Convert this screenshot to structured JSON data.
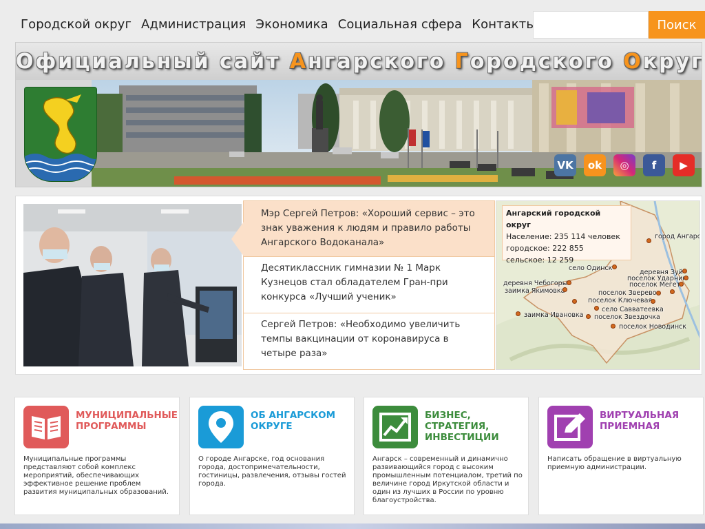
{
  "nav": {
    "items": [
      "Городской округ",
      "Администрация",
      "Экономика",
      "Социальная сфера",
      "Контакты"
    ],
    "search_placeholder": "",
    "search_button": "Поиск"
  },
  "banner": {
    "title_parts": [
      "Официальный сайт ",
      "А",
      "нгарского ",
      "Г",
      "ородского ",
      "О",
      "круга"
    ],
    "social": [
      "vk",
      "ok",
      "instagram",
      "facebook",
      "youtube"
    ]
  },
  "news": [
    {
      "text": "Мэр Сергей Петров: «Хороший сервис – это знак уважения к людям и правило работы Ангарского Водоканала»"
    },
    {
      "text": "Десятиклассник гимназии № 1 Марк Кузнецов стал обладателем Гран-при конкурса «Лучший ученик»"
    },
    {
      "text": "Сергей Петров: «Необходимо увеличить темпы вакцинации от коронавируса в четыре раза»"
    }
  ],
  "map": {
    "title": "Ангарский городской округ",
    "population": "Население: 235 114 человек",
    "urban": "городское: 222 855",
    "rural": "сельское: 12 259",
    "labels": [
      "город Ангарск",
      "село Одинск",
      "деревня Зуй",
      "поселок Ударник",
      "поселок Мегет",
      "деревня Чебогоры",
      "заимка Якимовка",
      "поселок Зверево",
      "поселок Ключевая",
      "село Савватеевка",
      "заимка Ивановка",
      "поселок Звездочка",
      "поселок Новодинск"
    ]
  },
  "cards": [
    {
      "title": "Муниципальные программы",
      "color": "#e05a5a",
      "desc": "Муниципальные программы представляют собой комплекс мероприятий, обеспечивающих эффективное решение проблем развития муниципальных образований."
    },
    {
      "title": "Об Ангарском округе",
      "color": "#1a9bd7",
      "desc": "О городе Ангарске, год основания города, достопримечательности, гостиницы, развлечения, отзывы гостей города."
    },
    {
      "title": "Бизнес, стратегия, инвестиции",
      "color": "#3c8c3c",
      "desc": "Ангарск – современный и динамично развивающийся город с высоким промышленным потенциалом, третий по величине город Иркутской области и один из лучших в России по уровню благоустройства."
    },
    {
      "title": "Виртуальная приемная",
      "color": "#a040b0",
      "desc": "Написать обращение в виртуальную приемную администрации."
    }
  ]
}
